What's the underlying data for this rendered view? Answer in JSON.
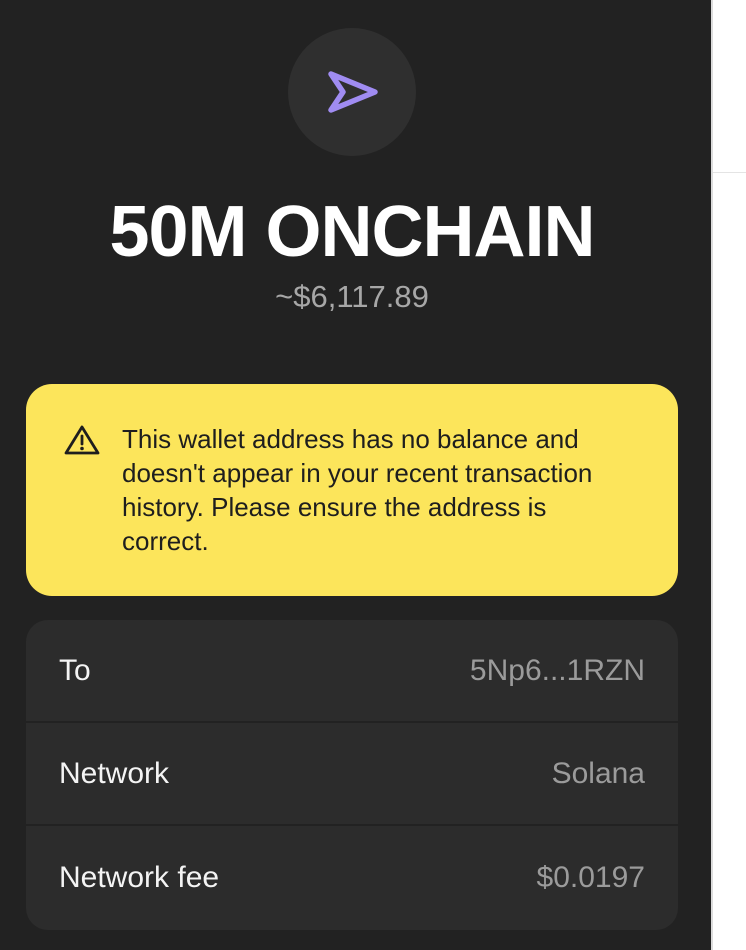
{
  "transaction": {
    "icon": "send-arrow-icon",
    "amount": "50M ONCHAIN",
    "fiat_value": "~$6,117.89"
  },
  "warning": {
    "icon": "warning-triangle-icon",
    "text": "This wallet address has no balance and doesn't appear in your recent transaction history. Please ensure the address is correct."
  },
  "details": [
    {
      "label": "To",
      "value": "5Np6...1RZN"
    },
    {
      "label": "Network",
      "value": "Solana"
    },
    {
      "label": "Network fee",
      "value": "$0.0197"
    }
  ],
  "colors": {
    "panel_bg": "#222222",
    "accent_purple": "#a08cf2",
    "warning_bg": "#fce55b",
    "card_bg": "#2c2c2c"
  }
}
